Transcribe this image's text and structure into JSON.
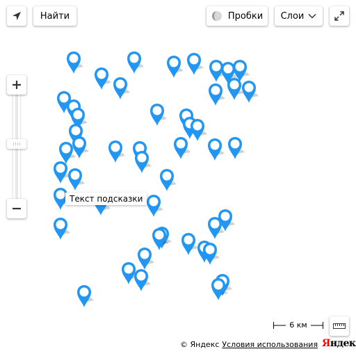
{
  "toolbar": {
    "find_label": "Найти",
    "traffic_label": "Пробки",
    "layers_label": "Слои"
  },
  "map": {
    "hint_text": "Текст подсказки",
    "scale_label": "6 км",
    "pin_color": "#2196f3",
    "pin_count": 61
  },
  "footer": {
    "copyright": "© Яндекс",
    "terms_label": "Условия использования",
    "logo_first": "Я",
    "logo_rest": "ндекс"
  },
  "colors": {
    "logo_red": "#ff0000",
    "pin": "#2196f3"
  }
}
